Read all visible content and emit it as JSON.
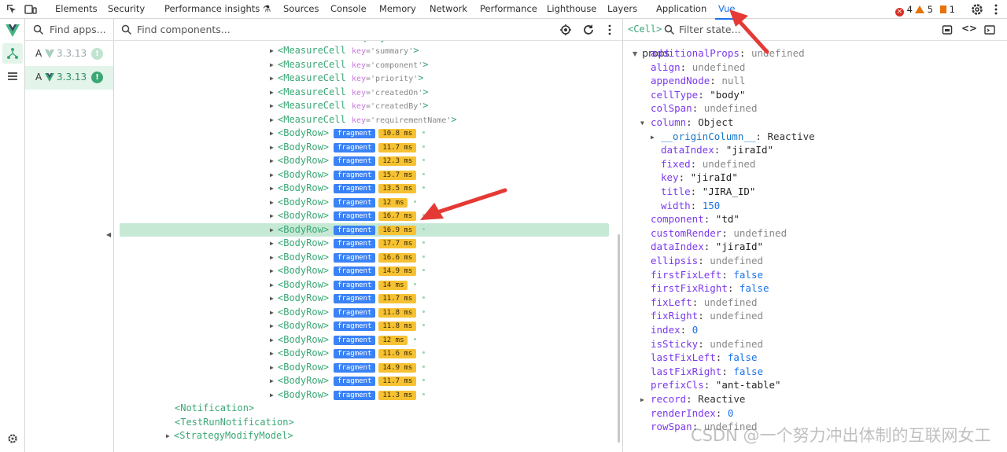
{
  "tabs": [
    "Elements",
    "Security",
    "Performance insights",
    "Sources",
    "Console",
    "Memory",
    "Network",
    "Performance",
    "Lighthouse",
    "Layers",
    "Application",
    "Vue"
  ],
  "active_tab": "Vue",
  "badges": {
    "errors": "4",
    "warnings": "5",
    "issues": "1"
  },
  "apps": {
    "search_placeholder": "Find apps...",
    "items": [
      {
        "letter": "A",
        "version": "3.3.13",
        "selected": false
      },
      {
        "letter": "A",
        "version": "3.3.13",
        "selected": true
      }
    ]
  },
  "components": {
    "search_placeholder": "Find components...",
    "top_partial": "<MeasureCell key='jiraId'>",
    "measure_cells": [
      "summary",
      "component",
      "priority",
      "createdOn",
      "createdBy",
      "requirementName"
    ],
    "body_rows": [
      {
        "badge": "fragment",
        "ms": "10.8 ms"
      },
      {
        "badge": "fragment",
        "ms": "11.7 ms"
      },
      {
        "badge": "fragment",
        "ms": "12.3 ms"
      },
      {
        "badge": "fragment",
        "ms": "15.7 ms"
      },
      {
        "badge": "fragment",
        "ms": "13.5 ms"
      },
      {
        "badge": "fragment",
        "ms": "12 ms"
      },
      {
        "badge": "fragment",
        "ms": "16.7 ms"
      },
      {
        "badge": "fragment",
        "ms": "16.9 ms",
        "selected": true
      },
      {
        "badge": "fragment",
        "ms": "17.7 ms"
      },
      {
        "badge": "fragment",
        "ms": "16.6 ms"
      },
      {
        "badge": "fragment",
        "ms": "14.9 ms"
      },
      {
        "badge": "fragment",
        "ms": "14 ms"
      },
      {
        "badge": "fragment",
        "ms": "11.7 ms"
      },
      {
        "badge": "fragment",
        "ms": "11.8 ms"
      },
      {
        "badge": "fragment",
        "ms": "11.8 ms"
      },
      {
        "badge": "fragment",
        "ms": "12 ms"
      },
      {
        "badge": "fragment",
        "ms": "11.6 ms"
      },
      {
        "badge": "fragment",
        "ms": "14.9 ms"
      },
      {
        "badge": "fragment",
        "ms": "11.7 ms"
      },
      {
        "badge": "fragment",
        "ms": "11.3 ms"
      }
    ],
    "tail": [
      "<Notification>",
      "<TestRunNotification>",
      "<StrategyModifyModel>"
    ]
  },
  "state": {
    "breadcrumb": "<Cell>",
    "filter_placeholder": "Filter state...",
    "section": "props",
    "props": [
      {
        "k": "additionalProps",
        "v": "undefined",
        "t": "undef",
        "lvl": 0
      },
      {
        "k": "align",
        "v": "undefined",
        "t": "undef",
        "lvl": 0
      },
      {
        "k": "appendNode",
        "v": "null",
        "t": "undef",
        "lvl": 0
      },
      {
        "k": "cellType",
        "v": "\"body\"",
        "t": "str",
        "lvl": 0
      },
      {
        "k": "colSpan",
        "v": "undefined",
        "t": "undef",
        "lvl": 0
      },
      {
        "k": "column",
        "v": "Object",
        "t": "obj",
        "lvl": 0,
        "expander": "open"
      },
      {
        "k": "__originColumn__",
        "v": "Reactive",
        "t": "obj",
        "lvl": 1,
        "expander": "closed"
      },
      {
        "k": "dataIndex",
        "v": "\"jiraId\"",
        "t": "str",
        "lvl": 1
      },
      {
        "k": "fixed",
        "v": "undefined",
        "t": "undef",
        "lvl": 1
      },
      {
        "k": "key",
        "v": "\"jiraId\"",
        "t": "str",
        "lvl": 1
      },
      {
        "k": "title",
        "v": "\"JIRA_ID\"",
        "t": "str",
        "lvl": 1
      },
      {
        "k": "width",
        "v": "150",
        "t": "num",
        "lvl": 1
      },
      {
        "k": "component",
        "v": "\"td\"",
        "t": "str",
        "lvl": 0
      },
      {
        "k": "customRender",
        "v": "undefined",
        "t": "undef",
        "lvl": 0
      },
      {
        "k": "dataIndex",
        "v": "\"jiraId\"",
        "t": "str",
        "lvl": 0
      },
      {
        "k": "ellipsis",
        "v": "undefined",
        "t": "undef",
        "lvl": 0
      },
      {
        "k": "firstFixLeft",
        "v": "false",
        "t": "kw",
        "lvl": 0
      },
      {
        "k": "firstFixRight",
        "v": "false",
        "t": "kw",
        "lvl": 0
      },
      {
        "k": "fixLeft",
        "v": "undefined",
        "t": "undef",
        "lvl": 0
      },
      {
        "k": "fixRight",
        "v": "undefined",
        "t": "undef",
        "lvl": 0
      },
      {
        "k": "index",
        "v": "0",
        "t": "num",
        "lvl": 0
      },
      {
        "k": "isSticky",
        "v": "undefined",
        "t": "undef",
        "lvl": 0
      },
      {
        "k": "lastFixLeft",
        "v": "false",
        "t": "kw",
        "lvl": 0
      },
      {
        "k": "lastFixRight",
        "v": "false",
        "t": "kw",
        "lvl": 0
      },
      {
        "k": "prefixCls",
        "v": "\"ant-table\"",
        "t": "str",
        "lvl": 0
      },
      {
        "k": "record",
        "v": "Reactive",
        "t": "obj",
        "lvl": 0,
        "expander": "closed"
      },
      {
        "k": "renderIndex",
        "v": "0",
        "t": "num",
        "lvl": 0
      },
      {
        "k": "rowSpan",
        "v": "undefined",
        "t": "undef",
        "lvl": 0
      }
    ]
  },
  "watermark": "CSDN @一个努力冲出体制的互联网女工"
}
